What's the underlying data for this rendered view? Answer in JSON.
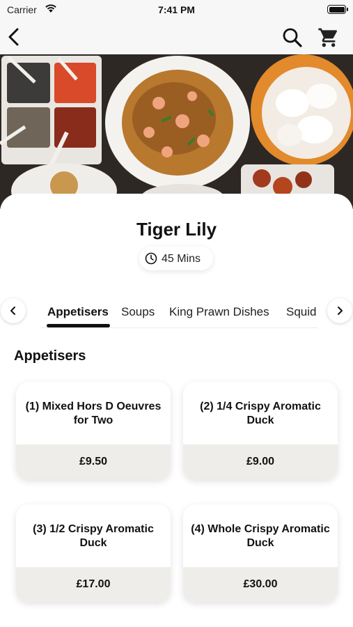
{
  "status_bar": {
    "carrier": "Carrier",
    "time": "7:41 PM"
  },
  "nav": {
    "back_icon": "chevron-left-icon",
    "search_icon": "search-icon",
    "cart_icon": "cart-icon"
  },
  "restaurant": {
    "name": "Tiger Lily",
    "eta": "45 Mins",
    "eta_icon": "clock-icon"
  },
  "category_tabs": {
    "items": [
      {
        "label": "Appetisers",
        "active": true
      },
      {
        "label": "Soups",
        "active": false
      },
      {
        "label": "King Prawn Dishes",
        "active": false
      },
      {
        "label": "Squid",
        "active": false
      }
    ],
    "prev_icon": "chevron-left-icon",
    "next_icon": "chevron-right-icon"
  },
  "section": {
    "title": "Appetisers"
  },
  "menu_items": [
    {
      "name": "(1) Mixed Hors D Oeuvres for Two",
      "price": "£9.50"
    },
    {
      "name": "(2) 1/4 Crispy Aromatic Duck",
      "price": "£9.00"
    },
    {
      "name": "(3) 1/2 Crispy Aromatic Duck",
      "price": "£17.00"
    },
    {
      "name": "(4) Whole Crispy Aromatic Duck",
      "price": "£30.00"
    }
  ],
  "colors": {
    "accent": "#111111",
    "price_band": "#efedea",
    "background": "#ffffff"
  }
}
